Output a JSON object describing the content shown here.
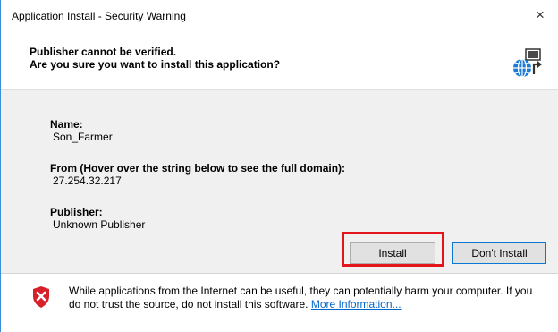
{
  "window": {
    "title": "Application Install - Security Warning",
    "close_glyph": "×"
  },
  "header": {
    "line1": "Publisher cannot be verified.",
    "line2": "Are you sure you want to install this application?",
    "icon": "globe-install-icon"
  },
  "details": {
    "name_label": "Name:",
    "name_value": "Son_Farmer",
    "from_label": "From (Hover over the string below to see the full domain):",
    "from_value": "27.254.32.217",
    "publisher_label": "Publisher:",
    "publisher_value": "Unknown Publisher"
  },
  "buttons": {
    "install": "Install",
    "dont_install": "Don't Install"
  },
  "footer": {
    "icon": "shield-x-icon",
    "warning_text": "While applications from the Internet can be useful, they can potentially harm your computer. If you do not trust the source, do not install this software.",
    "link_text": "More Information..."
  },
  "colors": {
    "highlight_border": "#e3151a",
    "link": "#0066cc",
    "shield_red": "#d6202a",
    "focus_blue": "#0a78d7"
  }
}
